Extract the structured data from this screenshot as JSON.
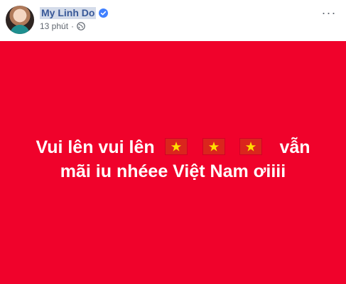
{
  "post": {
    "author_name": "My Linh Do",
    "timestamp": "13 phút",
    "separator": "·",
    "more_label": "···",
    "text_line1_before": "Vui lên vui lên",
    "text_line1_after": "vẫn",
    "text_line2": "mãi iu nhéee Việt Nam ơiiii",
    "flag_count": 3
  },
  "colors": {
    "background": "#f0022b",
    "author_link": "#385898",
    "flag_red": "#da251d",
    "flag_star": "#ffde00"
  },
  "icons": {
    "verified": "verified-badge-icon",
    "privacy": "globe-icon",
    "more": "more-options-icon"
  }
}
